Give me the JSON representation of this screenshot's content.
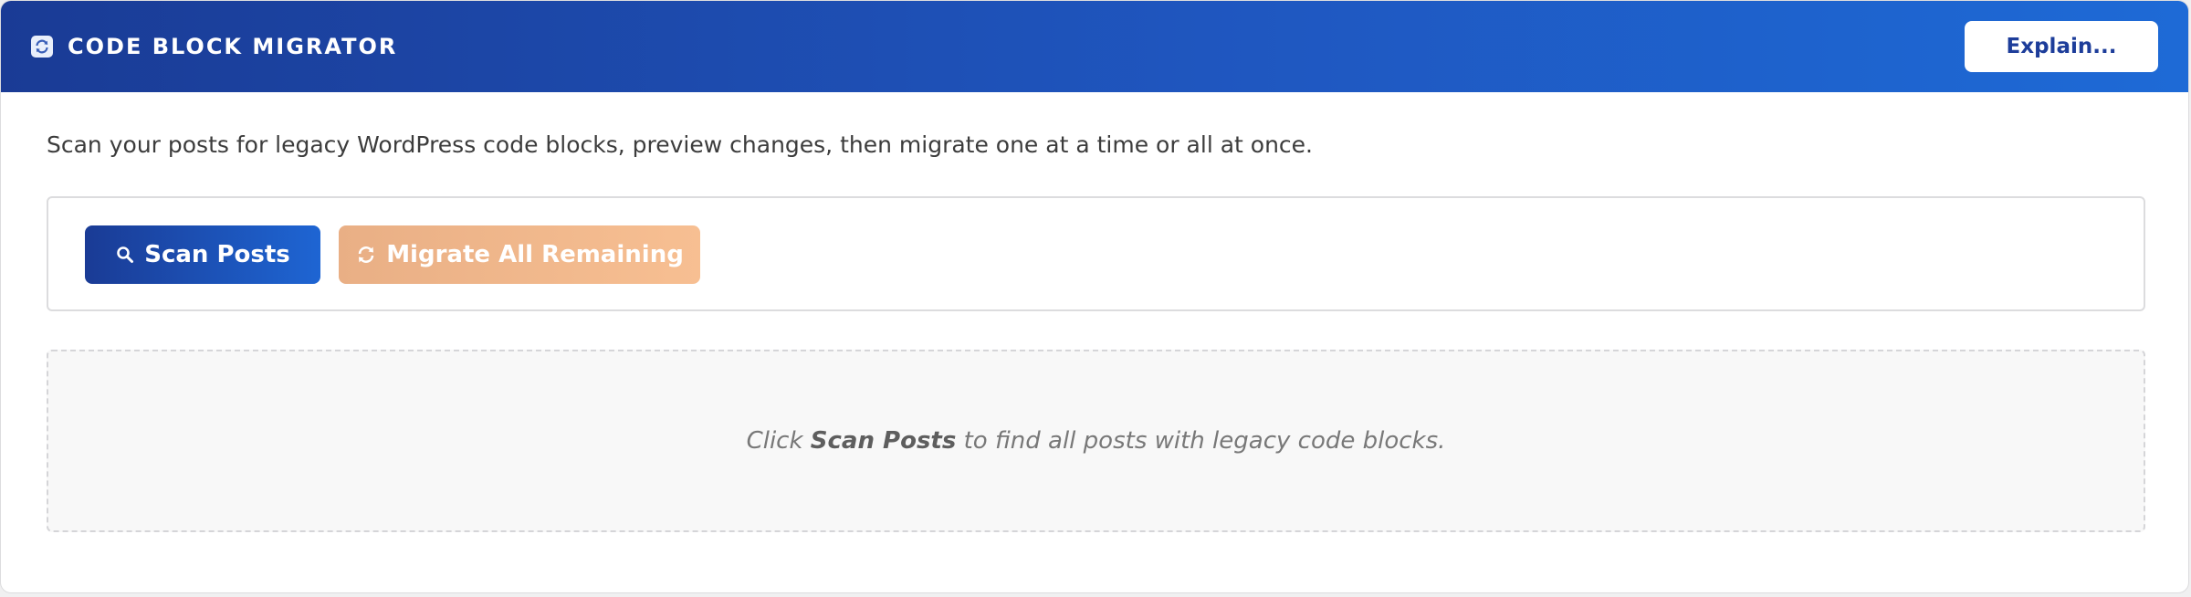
{
  "header": {
    "title": "CODE BLOCK MIGRATOR",
    "icon": "refresh-icon",
    "explain_label": "Explain...",
    "gradient_start": "#1a3b95",
    "gradient_end": "#1e6ad6"
  },
  "intro": {
    "text": "Scan your posts for legacy WordPress code blocks, preview changes, then migrate one at a time or all at once."
  },
  "actions": {
    "scan_label": "Scan Posts",
    "scan_icon": "search-icon",
    "migrate_label": "Migrate All Remaining",
    "migrate_icon": "refresh-icon",
    "migrate_color": "#f4b98c"
  },
  "empty_state": {
    "prefix": "Click ",
    "emphasis": "Scan Posts",
    "suffix": " to find all posts with legacy code blocks."
  }
}
